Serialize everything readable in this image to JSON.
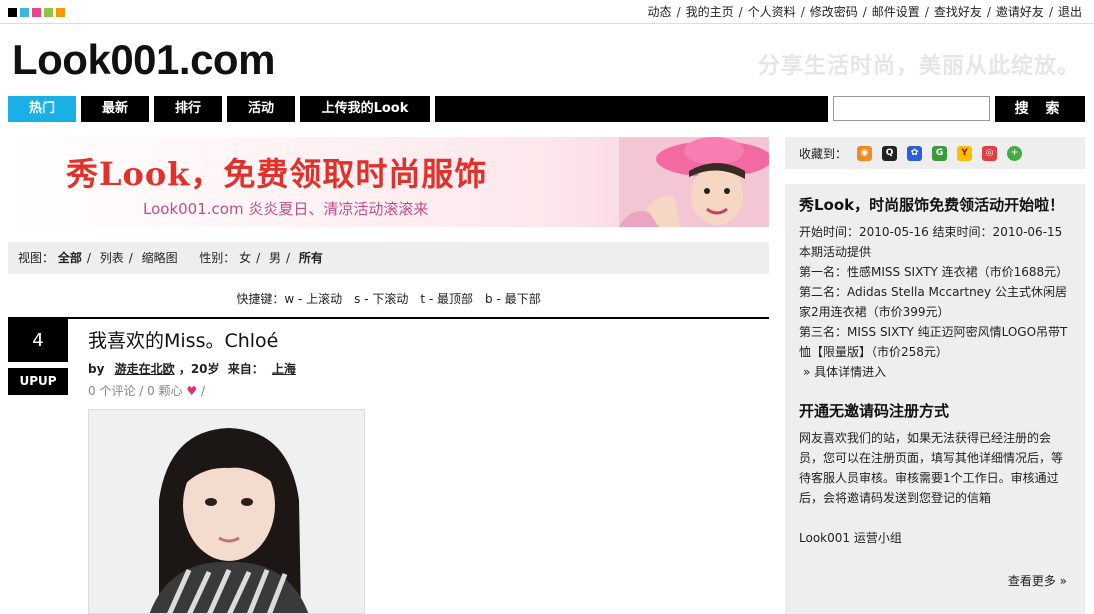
{
  "colors": {
    "accent": "#1ab0e6",
    "squares": [
      "#000000",
      "#38b6e8",
      "#e8458c",
      "#8cc63f",
      "#f39800"
    ]
  },
  "top_links": [
    "动态",
    "我的主页",
    "个人资料",
    "修改密码",
    "邮件设置",
    "查找好友",
    "邀请好友",
    "退出"
  ],
  "logo": "Look001.com",
  "slogan": "分享生活时尚，美丽从此绽放。",
  "nav": {
    "tabs": [
      "热门",
      "最新",
      "排行",
      "活动",
      "上传我的Look"
    ],
    "active": "热门",
    "search_label": "搜 索"
  },
  "banner": {
    "title": "秀Look，免费领取时尚服饰",
    "subtitle": "Look001.com 炎炎夏日、清凉活动滚滚来"
  },
  "view_bar": {
    "view_label": "视图：",
    "views": [
      "全部",
      "列表",
      "缩略图"
    ],
    "gender_label": "性别：",
    "genders": [
      "女",
      "男",
      "所有"
    ]
  },
  "hotkeys": "快捷键：w - 上滚动　s - 下滚动　t - 最顶部　b - 最下部",
  "post": {
    "rank": "4",
    "upup_label": "UPUP",
    "title": "我喜欢的Miss。Chloé",
    "by": "by",
    "author": "游走在北欧",
    "age": "20岁",
    "from_label": "来自：",
    "location": "上海",
    "comments": "0 个评论",
    "hearts": "0 颗心"
  },
  "sidebar": {
    "fav_label": "收藏到：",
    "fav_icons": [
      "rss-icon",
      "qq-icon",
      "baidu-icon",
      "google-icon",
      "yahoo-icon",
      "sina-icon",
      "add-icon"
    ],
    "box1": {
      "title": "秀Look，时尚服饰免费领活动开始啦！",
      "dates": "开始时间：2010-05-16 结束时间：2010-06-15",
      "provider": "本期活动提供",
      "prize1": "第一名：性感MISS SIXTY 连衣裙（市价1688元）",
      "prize2": "第二名：Adidas Stella Mccartney 公主式休闲居家2用连衣裙（市价399元）",
      "prize3": "第三名：MISS SIXTY 纯正迈阿密风情LOGO吊带T恤【限量版】（市价258元）",
      "details": "» 具体详情进入"
    },
    "box2": {
      "title": "开通无邀请码注册方式",
      "text": "网友喜欢我们的站，如果无法获得已经注册的会员，您可以在注册页面，填写其他详细情况后，等待客服人员审核。审核需要1个工作日。审核通过后，会将邀请码发送到您登记的信箱",
      "team": "Look001 运营小组",
      "more": "查看更多 »"
    }
  }
}
